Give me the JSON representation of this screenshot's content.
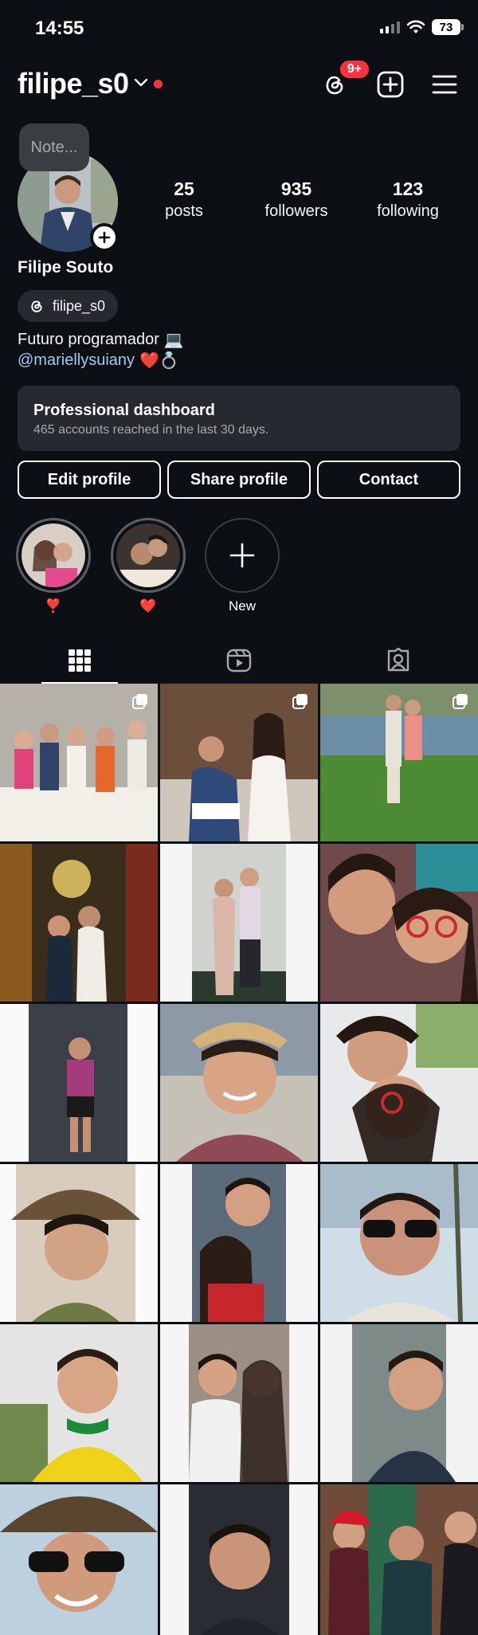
{
  "status": {
    "time": "14:55",
    "battery": "73"
  },
  "header": {
    "username": "filipe_s0",
    "threads_badge": "9+"
  },
  "profile": {
    "note_placeholder": "Note...",
    "stats": [
      {
        "num": "25",
        "label": "posts"
      },
      {
        "num": "935",
        "label": "followers"
      },
      {
        "num": "123",
        "label": "following"
      }
    ],
    "full_name": "Filipe Souto",
    "threads_handle": "filipe_s0",
    "bio_line1": "Futuro programador",
    "bio_line1_emoji": "💻",
    "bio_mention": "@mariellysuiany",
    "bio_line2_emoji": "❤️💍"
  },
  "dashboard": {
    "title": "Professional dashboard",
    "subtitle": "465 accounts reached in the last 30 days."
  },
  "actions": {
    "edit": "Edit profile",
    "share": "Share profile",
    "contact": "Contact"
  },
  "highlights": [
    {
      "label": "❣️"
    },
    {
      "label": "❤️"
    },
    {
      "label": "New"
    }
  ],
  "tabs": [
    {
      "icon": "grid-icon",
      "active": true
    },
    {
      "icon": "reels-icon",
      "active": false
    },
    {
      "icon": "tagged-icon",
      "active": false
    }
  ],
  "colors": {
    "accent": "#ff3040",
    "mention": "#a4c8f0",
    "background": "#0c1014"
  }
}
